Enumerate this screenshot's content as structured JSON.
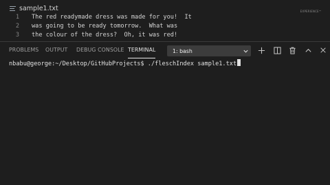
{
  "editor": {
    "tab_name": "sample1.txt",
    "minimap_label": "EXPERIENCE™",
    "lines": [
      {
        "number": "1",
        "text": "The red readymade dress was made for you!  It"
      },
      {
        "number": "2",
        "text": "was going to be ready tomorrow.  What was"
      },
      {
        "number": "3",
        "text": "the colour of the dress?  Oh, it was red!"
      }
    ]
  },
  "panel": {
    "tabs": [
      "PROBLEMS",
      "OUTPUT",
      "DEBUG CONSOLE",
      "TERMINAL"
    ],
    "active_tab": "TERMINAL",
    "terminal_select": "1: bash",
    "actions": [
      "add-terminal",
      "split-terminal",
      "kill-terminal",
      "maximize-panel",
      "close-panel"
    ]
  },
  "terminal": {
    "prompt": "nbabu@george:~/Desktop/GitHubProjects$ ",
    "command": "./fleschIndex sample1.txt"
  },
  "colors": {
    "background": "#1e1e1e",
    "line_number": "#858585",
    "text": "#d4d4d4",
    "select_bg": "#3c3c3c"
  }
}
